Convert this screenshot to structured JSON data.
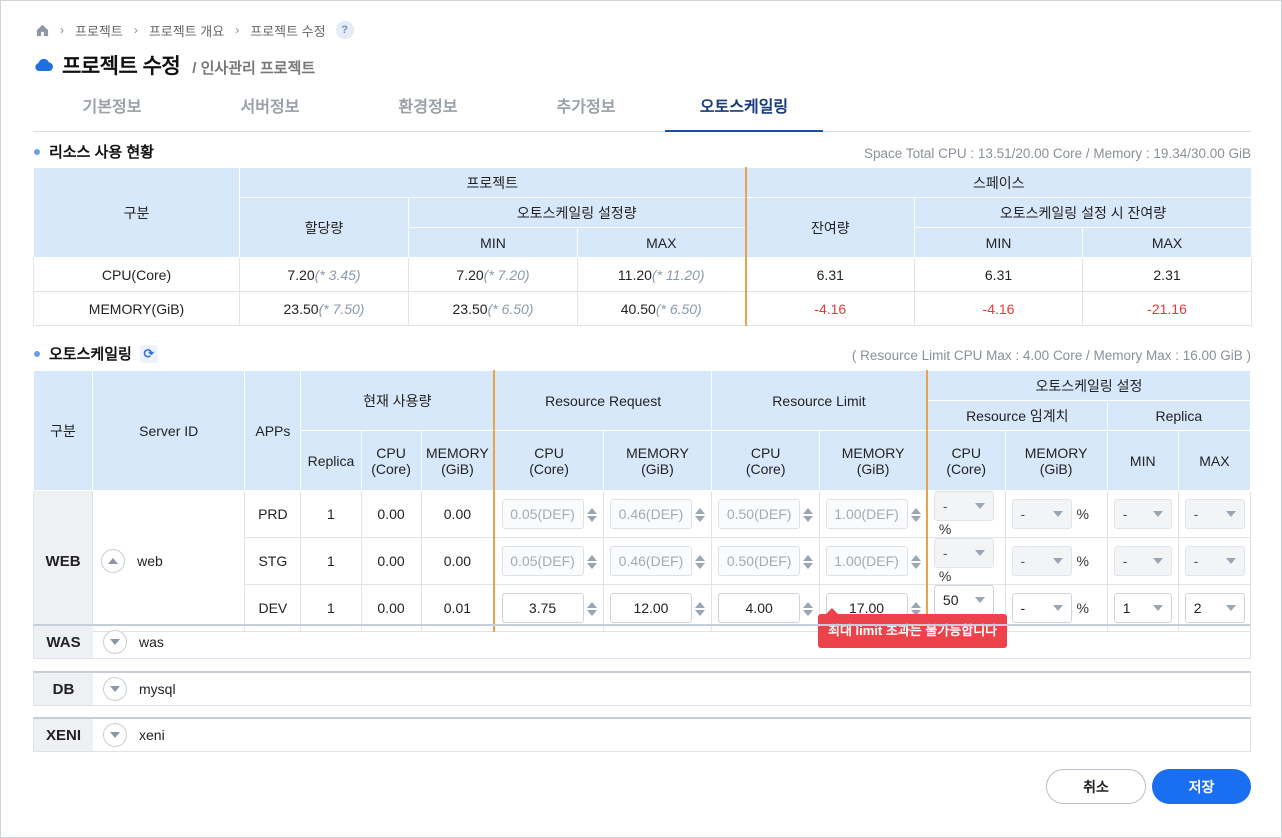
{
  "breadcrumb": [
    "프로젝트",
    "프로젝트 개요",
    "프로젝트 수정"
  ],
  "help": "?",
  "title": "프로젝트 수정",
  "subtitle": "/ 인사관리 프로젝트",
  "tabs": [
    "기본정보",
    "서버정보",
    "환경정보",
    "추가정보",
    "오토스케일링"
  ],
  "resource": {
    "heading": "리소스 사용 현황",
    "note": "Space Total CPU : 13.51/20.00 Core / Memory : 19.34/30.00 GiB",
    "h": {
      "gubun": "구분",
      "project": "프로젝트",
      "space": "스페이스",
      "alloc": "할당량",
      "as_set": "오토스케일링 설정량",
      "min": "MIN",
      "max": "MAX",
      "remain": "잔여량",
      "as_remain": "오토스케일링 설정 시 잔여량"
    },
    "rows": [
      {
        "label": "CPU(Core)",
        "alloc": "7.20",
        "alloc_t": "(* 3.45)",
        "min": "7.20",
        "min_t": "(* 7.20)",
        "max": "11.20",
        "max_t": "(* 11.20)",
        "remain": "6.31",
        "rmin": "6.31",
        "rmax": "2.31"
      },
      {
        "label": "MEMORY(GiB)",
        "alloc": "23.50",
        "alloc_t": "(* 7.50)",
        "min": "23.50",
        "min_t": "(* 6.50)",
        "max": "40.50",
        "max_t": "(* 6.50)",
        "remain": "-4.16",
        "rmin": "-4.16",
        "rmax": "-21.16"
      }
    ]
  },
  "autoscale": {
    "heading": "오토스케일링",
    "note": "( Resource Limit CPU Max : 4.00 Core / Memory Max : 16.00 GiB )",
    "h": {
      "gubun": "구분",
      "server": "Server ID",
      "apps": "APPs",
      "usage": "현재 사용량",
      "req": "Resource Request",
      "lim": "Resource Limit",
      "as": "오토스케일링 설정",
      "thr": "Resource 임계치",
      "rep": "Replica",
      "replica": "Replica",
      "cpu1": "CPU",
      "cpu2": "(Core)",
      "mem1": "MEMORY",
      "mem2": "(GiB)",
      "min": "MIN",
      "max": "MAX"
    },
    "group": "WEB",
    "server": "web",
    "pct": "%",
    "rows": [
      {
        "app": "PRD",
        "rep": "1",
        "cpu": "0.00",
        "mem": "0.00",
        "rcpu": "0.05(DEF)",
        "rmem": "0.46(DEF)",
        "lcpu": "0.50(DEF)",
        "lmem": "1.00(DEF)",
        "tcpu": "-",
        "tmem": "-",
        "rmin": "-",
        "rmax": "-"
      },
      {
        "app": "STG",
        "rep": "1",
        "cpu": "0.00",
        "mem": "0.00",
        "rcpu": "0.05(DEF)",
        "rmem": "0.46(DEF)",
        "lcpu": "0.50(DEF)",
        "lmem": "1.00(DEF)",
        "tcpu": "-",
        "tmem": "-",
        "rmin": "-",
        "rmax": "-"
      },
      {
        "app": "DEV",
        "rep": "1",
        "cpu": "0.00",
        "mem": "0.01",
        "rcpu": "3.75",
        "rmem": "12.00",
        "lcpu": "4.00",
        "lmem": "17.00",
        "tcpu": "50",
        "tmem": "-",
        "rmin": "1",
        "rmax": "2"
      }
    ],
    "groups": [
      {
        "g": "WAS",
        "s": "was"
      },
      {
        "g": "DB",
        "s": "mysql"
      },
      {
        "g": "XENI",
        "s": "xeni"
      }
    ]
  },
  "tooltip": "최대 limit 초과는 불가능합니다",
  "buttons": {
    "cancel": "취소",
    "save": "저장"
  }
}
